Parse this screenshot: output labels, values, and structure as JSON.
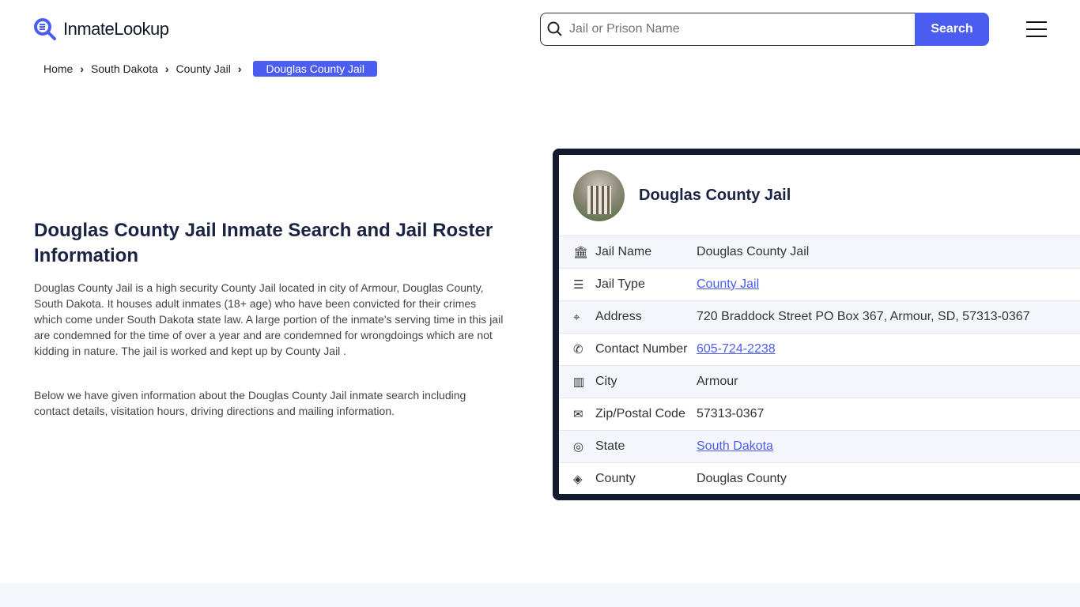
{
  "brand": {
    "name": "InmateLookup"
  },
  "search": {
    "placeholder": "Jail or Prison Name",
    "button": "Search"
  },
  "breadcrumb": [
    "Home",
    "South Dakota",
    "County Jail",
    "Douglas County Jail"
  ],
  "main": {
    "title": "Douglas County Jail Inmate Search and Jail Roster Information",
    "paragraphs": [
      "Douglas County Jail is a high security County Jail located in city of Armour, Douglas County, South Dakota. It houses adult inmates (18+ age) who have been convicted for their crimes which come under South Dakota state law. A large portion of the inmate's serving time in this jail are condemned for the time of over a year and are condemned for wrongdoings which are not kidding in nature. The jail is worked and kept up by County Jail .",
      "Below we have given information about the Douglas County Jail inmate search including contact details, visitation hours, driving directions and mailing information."
    ]
  },
  "card": {
    "title": "Douglas County Jail",
    "rows": [
      {
        "icon": "bank-icon",
        "label": "Jail Name",
        "value": "Douglas County Jail"
      },
      {
        "icon": "list-icon",
        "label": "Jail Type",
        "value": "County Jail",
        "link": true
      },
      {
        "icon": "map-pin-icon",
        "label": "Address",
        "value": "720 Braddock Street PO Box 367, Armour, SD, 57313-0367"
      },
      {
        "icon": "phone-icon",
        "label": "Contact Number",
        "value": "605-724-2238",
        "link": true
      },
      {
        "icon": "map-icon",
        "label": "City",
        "value": "Armour"
      },
      {
        "icon": "mail-icon",
        "label": "Zip/Postal Code",
        "value": "57313-0367"
      },
      {
        "icon": "globe-icon",
        "label": "State",
        "value": "South Dakota",
        "link": true
      },
      {
        "icon": "county-icon",
        "label": "County",
        "value": "Douglas County"
      }
    ]
  },
  "colors": {
    "accent": "#4b5cf0",
    "card_border": "#111a2e",
    "heading": "#1a2341"
  }
}
